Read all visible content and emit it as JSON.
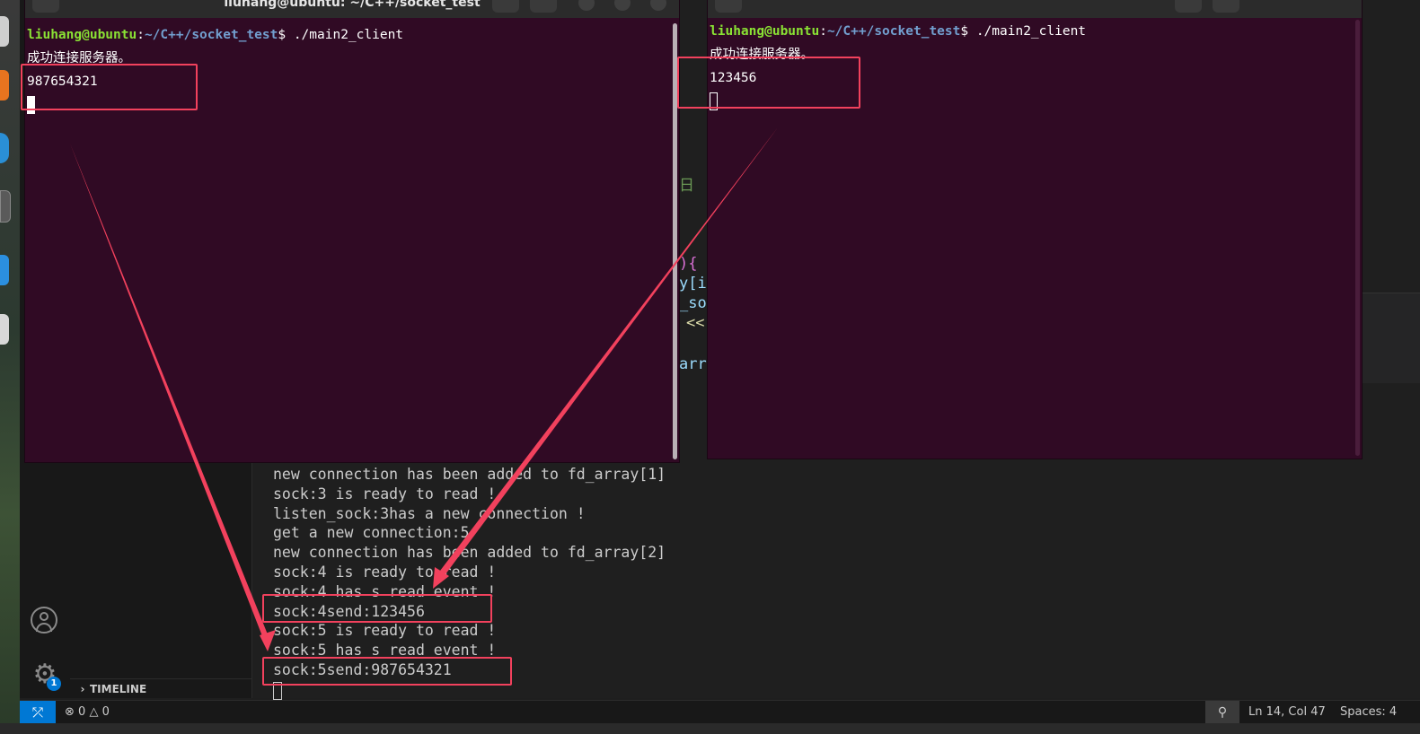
{
  "left_terminal": {
    "title": "liuhang@ubuntu: ~/C++/socket_test",
    "prompt_user": "liuhang@ubuntu",
    "prompt_sep": ":",
    "prompt_path": "~/C++/socket_test",
    "prompt_suffix": "$ ./main2_client",
    "lines": [
      "成功连接服务器。",
      "987654321"
    ]
  },
  "right_terminal": {
    "prompt_user": "liuhang@ubuntu",
    "prompt_sep": ":",
    "prompt_path": "~/C++/socket_test",
    "prompt_suffix": "$ ./main2_client",
    "lines": [
      "成功连接服务器。",
      "123456"
    ]
  },
  "server_output": [
    "new connection has been added to fd_array[1]",
    "sock:3 is ready to read !",
    "listen_sock:3has a new connection !",
    "get a new connection:5",
    "new connection has been added to fd_array[2]",
    "sock:4 is ready to read !",
    "sock:4 has s read event !",
    "sock:4send:123456",
    "sock:5 is ready to read !",
    "sock:5 has s read event !",
    "sock:5send:987654321"
  ],
  "code_fragments": [
    "日",
    "){",
    "y[i",
    "_so",
    "<<",
    "arr"
  ],
  "sidebar": {
    "timeline_label": "TIMELINE"
  },
  "activity": {
    "settings_badge": "1"
  },
  "statusbar": {
    "errors": "0",
    "warnings": "0",
    "position": "Ln 14, Col 47",
    "spaces": "Spaces: 4"
  },
  "colors": {
    "terminal_bg": "#300a24",
    "prompt_user": "#8ae234",
    "prompt_path": "#729fcf",
    "annotation": "#f2415d",
    "remote_button": "#0078d4"
  }
}
